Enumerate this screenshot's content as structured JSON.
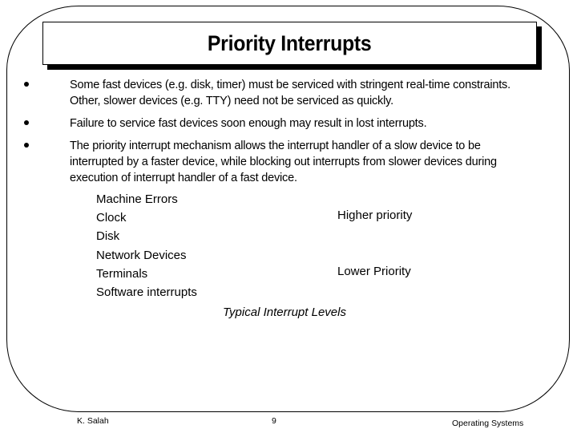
{
  "slide": {
    "title": "Priority Interrupts",
    "bullets": [
      "Some fast devices (e.g. disk, timer) must be serviced with stringent real-time constraints. Other, slower devices (e.g. TTY) need not be serviced as quickly.",
      "Failure to service fast devices soon enough may result in lost interrupts.",
      "The priority interrupt mechanism allows the interrupt handler of a slow device to be interrupted by a faster device, while blocking out interrupts from slower devices during execution of interrupt handler of a fast device."
    ],
    "interrupt_levels": [
      "Machine Errors",
      "Clock",
      "Disk",
      "Network Devices",
      "Terminals",
      "Software interrupts"
    ],
    "higher_priority_label": "Higher priority",
    "lower_priority_label": "Lower Priority",
    "caption": "Typical Interrupt Levels"
  },
  "footer": {
    "author": "K. Salah",
    "page_number": "9",
    "course": "Operating Systems"
  }
}
